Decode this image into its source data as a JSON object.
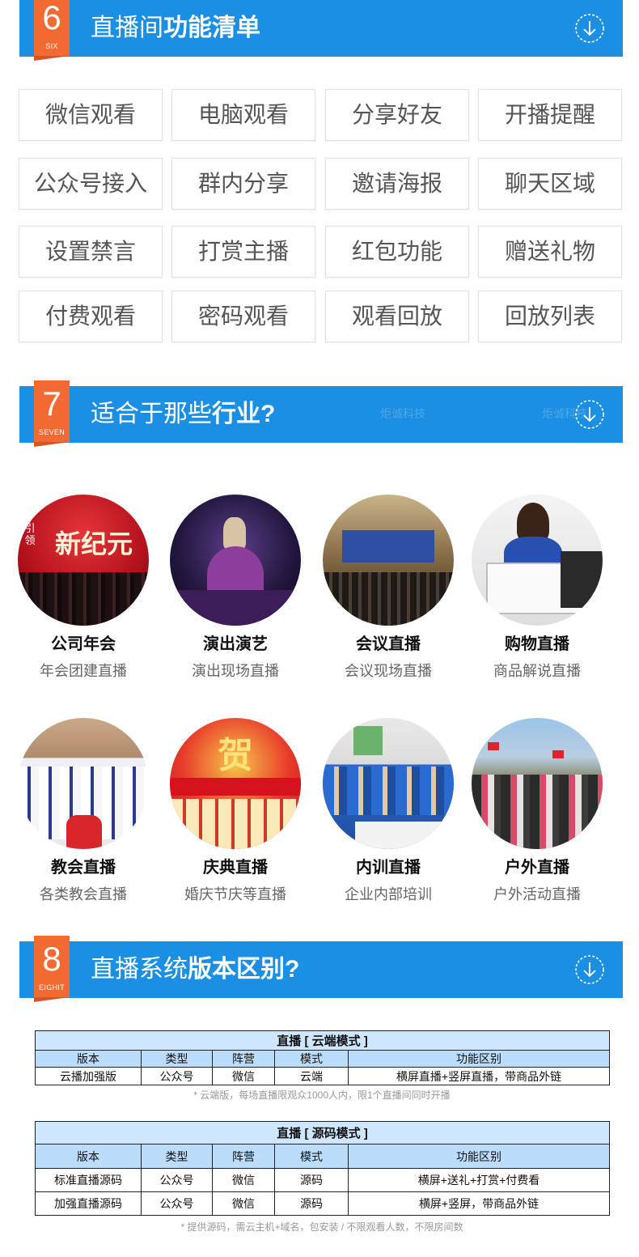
{
  "section6": {
    "number": "6",
    "word": "SIX",
    "title_prefix": "直播间",
    "title_bold": "功能清单",
    "features": [
      "微信观看",
      "电脑观看",
      "分享好友",
      "开播提醒",
      "公众号接入",
      "群内分享",
      "邀请海报",
      "聊天区域",
      "设置禁言",
      "打赏主播",
      "红包功能",
      "赠送礼物",
      "付费观看",
      "密码观看",
      "观看回放",
      "回放列表"
    ]
  },
  "section7": {
    "number": "7",
    "word": "SEVEN",
    "title_prefix": "适合于那些",
    "title_bold": "行业?",
    "watermark": "炬诚科技",
    "industries": [
      {
        "name": "公司年会",
        "desc": "年会团建直播"
      },
      {
        "name": "演出演艺",
        "desc": "演出现场直播"
      },
      {
        "name": "会议直播",
        "desc": "会议现场直播"
      },
      {
        "name": "购物直播",
        "desc": "商品解说直播"
      },
      {
        "name": "教会直播",
        "desc": "各类教会直播"
      },
      {
        "name": "庆典直播",
        "desc": "婚庆节庆等直播"
      },
      {
        "name": "内训直播",
        "desc": "企业内部培训"
      },
      {
        "name": "户外直播",
        "desc": "户外活动直播"
      }
    ],
    "photo_texts": {
      "gala": "新纪元",
      "gala_side": "引领",
      "celebration": "贺"
    }
  },
  "section8": {
    "number": "8",
    "word": "EIGHIT",
    "title_prefix": "直播系统",
    "title_bold": "版本区别?",
    "headers": [
      "版本",
      "类型",
      "阵营",
      "模式",
      "功能区别"
    ],
    "cloud": {
      "caption": "直播 [ 云端模式 ]",
      "rows": [
        [
          "云播加强版",
          "公众号",
          "微信",
          "云端",
          "横屏直播+竖屏直播，带商品外链"
        ]
      ],
      "note": "* 云端版，每场直播限观众1000人内，限1个直播间同时开播"
    },
    "source": {
      "caption": "直播 [ 源码模式 ]",
      "rows": [
        [
          "标准直播源码",
          "公众号",
          "微信",
          "源码",
          "横屏+送礼+打赏+付费看"
        ],
        [
          "加强直播源码",
          "公众号",
          "微信",
          "源码",
          "横屏+竖屏，带商品外链"
        ]
      ],
      "note": "* 提供源码，需云主机+域名，包安装 / 不限观看人数，不限房间数"
    }
  },
  "colors": {
    "header_blue": "#1a8fe3",
    "badge_orange": "#f36a32",
    "table_head": "#bcdcfb"
  },
  "icons": {
    "header_action": "arrow-down-circle-icon"
  }
}
